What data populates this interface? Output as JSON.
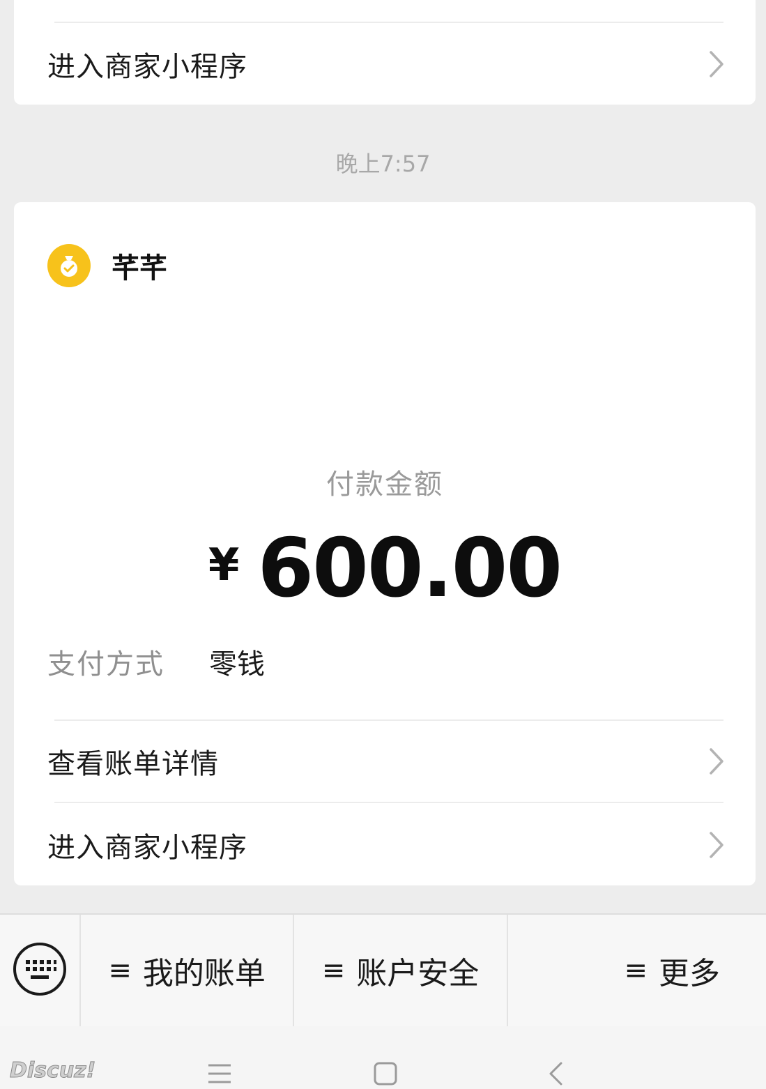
{
  "top_card": {
    "row_label": "进入商家小程序"
  },
  "timestamp": "晚上7:57",
  "payment_card": {
    "merchant_name": "芊芊",
    "amount_label": "付款金额",
    "currency_symbol": "¥",
    "amount_value": "600.00",
    "pay_method_key": "支付方式",
    "pay_method_value": "零钱",
    "rows": [
      {
        "label": "查看账单详情"
      },
      {
        "label": "进入商家小程序"
      }
    ],
    "logo_color": "#f7c21b"
  },
  "menu": {
    "items": [
      {
        "icon": "≡",
        "label": "我的账单"
      },
      {
        "icon": "≡",
        "label": "账户安全"
      },
      {
        "icon": "≡",
        "label": "更多"
      }
    ]
  },
  "watermark": "Discuz!"
}
